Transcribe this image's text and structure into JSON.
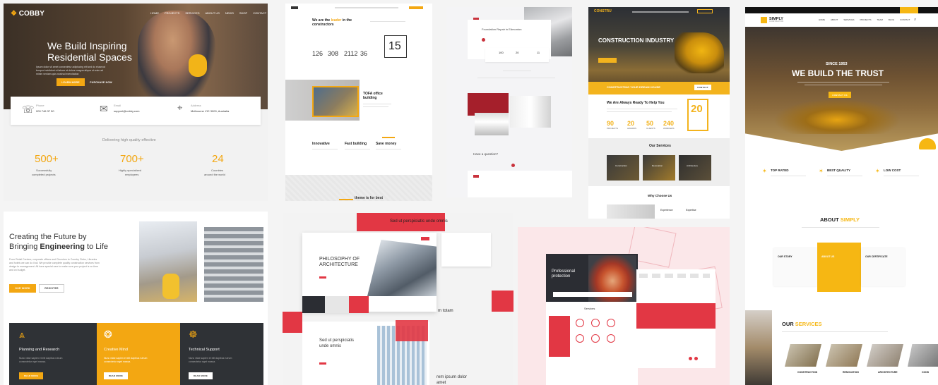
{
  "colors": {
    "yellow": "#f3a712",
    "gold": "#f6b713",
    "red": "#e23744",
    "dark": "#2f3236",
    "darkest": "#1b1d20"
  },
  "cobby": {
    "logo": "COBBY",
    "nav": [
      "HOME",
      "PROJECTS",
      "SERVICES",
      "ABOUT US",
      "NEWS",
      "SHOP",
      "CONTACT"
    ],
    "headline1": "We Build Inspiring",
    "headline2": "Residential Spaces",
    "sub1": "Ipsum dolor sit amet consectetur adipiscing elit sed do eiusmod",
    "sub2": "tempor incididunt ut labore et dolore magna aliqua ut enim ad",
    "sub3": "minim veniam quis nostrud exercitation",
    "btn_primary": "LEARN MORE",
    "btn_secondary": "PURCHASE NOW",
    "contacts": [
      {
        "label": "Phone",
        "value": "000 746 37 50"
      },
      {
        "label": "Email",
        "value": "support@cobby.com"
      },
      {
        "label": "Address",
        "value": "Melbourne VIC 3000, Australia"
      }
    ],
    "tagline": "Delivering high quality effective",
    "stats": [
      {
        "num": "500+",
        "l1": "Successfully",
        "l2": "completed projects"
      },
      {
        "num": "700+",
        "l1": "Highly specialized",
        "l2": "employees"
      },
      {
        "num": "24",
        "l1": "Countries",
        "l2": "around the world"
      }
    ]
  },
  "creating": {
    "line1": "Creating the Future by",
    "line2_pre": "Bringing ",
    "line2_bold": "Engineering",
    "line2_post": " to Life",
    "p1": "From Retail Centers, corporate offices and Churches to Country Clubs, Libraries",
    "p2": "and hotels we can do it all. We provide complete quality construction services from",
    "p3": "design to management. All have special care to make sure your project is on time",
    "p4": "and on budget.",
    "btn_primary": "OUR WORK",
    "btn_secondary": "REGISTER",
    "cards": [
      {
        "title": "Planning and Research",
        "text1": "Nunc vitae sapien et elit dapibus rutrum",
        "text2": "consectetur eget massa.",
        "btn": "READ MORE"
      },
      {
        "title": "Creative Mind",
        "text1": "Nunc vitae sapien et elit dapibus rutrum",
        "text2": "consectetur eget massa.",
        "btn": "READ MORE"
      },
      {
        "title": "Technical Support",
        "text1": "Nunc vitae sapien et elit dapibus rutrum",
        "text2": "consectetur eget massa.",
        "btn": "READ MORE"
      }
    ]
  },
  "constructors": {
    "headline1": "We are the",
    "headline_hl": "leader",
    "headline_post": "in the",
    "headline2": "constructors",
    "counters": [
      "126",
      "308",
      "2112",
      "36"
    ],
    "years": "15",
    "card_title1": "TOFA office",
    "card_title2": "building",
    "features": [
      "Innovative",
      "Fast building",
      "Save money"
    ],
    "bottom": "theme is for best"
  },
  "foundation": {
    "title": "Foundation Repair in Edmonton",
    "question": "Have a question?",
    "counters": [
      "100",
      "20",
      "11"
    ]
  },
  "cons_industry": {
    "logo": "CONSTRU",
    "title": "CONSTRUCTION INDUSTRY",
    "bar_text": "CONSTRUCTING YOUR DREAM HOUSE",
    "bar_btn": "CONTACT",
    "ready": "We Are Always Ready To Help You",
    "years": "20",
    "stats": [
      {
        "num": "90",
        "label": "PROJECTS"
      },
      {
        "num": "20",
        "label": "AWARDS"
      },
      {
        "num": "50",
        "label": "CLIENTS"
      },
      {
        "num": "240",
        "label": "WORKERS"
      }
    ],
    "services_title": "Our Services",
    "services": [
      "Construction",
      "Renovation",
      "Architecture"
    ],
    "why": "Why Choose Us",
    "why_items": [
      "Experience",
      "Expertise"
    ]
  },
  "simply": {
    "logo": "SIMPLY",
    "logo_sub": "CONSTRUCTION",
    "nav": [
      "HOME",
      "ABOUT",
      "SERVICES",
      "PROJECTS",
      "TEAM",
      "BLOG",
      "CONTACT"
    ],
    "since": "SINCE 1953",
    "headline": "WE BUILD THE TRUST",
    "btn": "CONTACT US",
    "features": [
      "TOP RATED",
      "BEST QUALITY",
      "LOW COST"
    ],
    "about_pre": "ABOUT ",
    "about_hl": "SIMPLY",
    "about_cols": [
      "OUR STORY",
      "ABOUT US",
      "OUR CERTIFICATE"
    ],
    "services_pre": "OUR ",
    "services_hl": "SERVICES",
    "service_names": [
      "CONSTRUCTION",
      "RENOVATION",
      "ARCHITECTURE",
      "CONS"
    ]
  },
  "philosophy": {
    "ribbon": "Sed ut perspiciatis unde omnis",
    "title1": "PHILOSOPHY OF",
    "title2": "ARCHITECTURE",
    "card_title1": "Sed ut perspiciatis",
    "card_title2": "unde omnis",
    "side_text": "m totam",
    "footer1": "rem ipsum dolor",
    "footer2": "amet"
  },
  "professional": {
    "title1": "Professional",
    "title2": "protection",
    "section": "Services"
  }
}
